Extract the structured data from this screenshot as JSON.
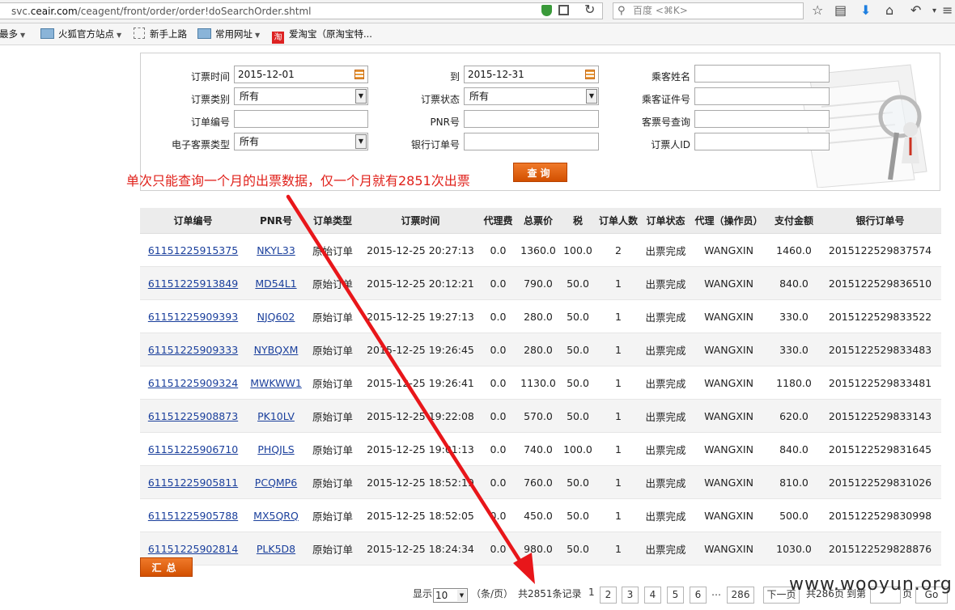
{
  "browser": {
    "url_prefix": "svc.",
    "url_domain": "ceair.com",
    "url_path": "/ceagent/front/order/order!doSearchOrder.shtml",
    "search_placeholder": "百度 <⌘K>",
    "bookmarks": [
      {
        "label": "访问最多"
      },
      {
        "label": "火狐官方站点"
      },
      {
        "label": "新手上路"
      },
      {
        "label": "常用网址"
      },
      {
        "label": "爱淘宝（原淘宝特..."
      }
    ]
  },
  "form": {
    "order_time_label": "订票时间",
    "order_time_from": "2015-12-01",
    "to_label": "到",
    "order_time_to": "2015-12-31",
    "passenger_name_label": "乘客姓名",
    "order_type_label": "订票类别",
    "order_type_value": "所有",
    "order_status_label": "订票状态",
    "order_status_value": "所有",
    "passenger_id_label": "乘客证件号",
    "order_no_label": "订单编号",
    "pnr_label": "PNR号",
    "ticket_query_label": "客票号查询",
    "eticket_type_label": "电子客票类型",
    "eticket_type_value": "所有",
    "bank_order_label": "银行订单号",
    "booker_id_label": "订票人ID",
    "query_button": "查询"
  },
  "annotation": "单次只能查询一个月的出票数据，仅一个月就有2851次出票",
  "table": {
    "headers": [
      "订单编号",
      "PNR号",
      "订单类型",
      "订票时间",
      "代理费",
      "总票价",
      "税",
      "订单人数",
      "订单状态",
      "代理（操作员）",
      "支付金额",
      "银行订单号"
    ],
    "rows": [
      [
        "61151225915375",
        "NKYL33",
        "原始订单",
        "2015-12-25 20:27:13",
        "0.0",
        "1360.0",
        "100.0",
        "2",
        "出票完成",
        "WANGXIN",
        "1460.0",
        "2015122529837574"
      ],
      [
        "61151225913849",
        "MD54L1",
        "原始订单",
        "2015-12-25 20:12:21",
        "0.0",
        "790.0",
        "50.0",
        "1",
        "出票完成",
        "WANGXIN",
        "840.0",
        "2015122529836510"
      ],
      [
        "61151225909393",
        "NJQ602",
        "原始订单",
        "2015-12-25 19:27:13",
        "0.0",
        "280.0",
        "50.0",
        "1",
        "出票完成",
        "WANGXIN",
        "330.0",
        "2015122529833522"
      ],
      [
        "61151225909333",
        "NYBQXM",
        "原始订单",
        "2015-12-25 19:26:45",
        "0.0",
        "280.0",
        "50.0",
        "1",
        "出票完成",
        "WANGXIN",
        "330.0",
        "2015122529833483"
      ],
      [
        "61151225909324",
        "MWKWW1",
        "原始订单",
        "2015-12-25 19:26:41",
        "0.0",
        "1130.0",
        "50.0",
        "1",
        "出票完成",
        "WANGXIN",
        "1180.0",
        "2015122529833481"
      ],
      [
        "61151225908873",
        "PK10LV",
        "原始订单",
        "2015-12-25 19:22:08",
        "0.0",
        "570.0",
        "50.0",
        "1",
        "出票完成",
        "WANGXIN",
        "620.0",
        "2015122529833143"
      ],
      [
        "61151225906710",
        "PHQJLS",
        "原始订单",
        "2015-12-25 19:01:13",
        "0.0",
        "740.0",
        "100.0",
        "1",
        "出票完成",
        "WANGXIN",
        "840.0",
        "2015122529831645"
      ],
      [
        "61151225905811",
        "PCQMP6",
        "原始订单",
        "2015-12-25 18:52:19",
        "0.0",
        "760.0",
        "50.0",
        "1",
        "出票完成",
        "WANGXIN",
        "810.0",
        "2015122529831026"
      ],
      [
        "61151225905788",
        "MX5QRQ",
        "原始订单",
        "2015-12-25 18:52:05",
        "0.0",
        "450.0",
        "50.0",
        "1",
        "出票完成",
        "WANGXIN",
        "500.0",
        "2015122529830998"
      ],
      [
        "61151225902814",
        "PLK5D8",
        "原始订单",
        "2015-12-25 18:24:34",
        "0.0",
        "980.0",
        "50.0",
        "1",
        "出票完成",
        "WANGXIN",
        "1030.0",
        "2015122529828876"
      ]
    ]
  },
  "summary_button": "汇总",
  "pager": {
    "show_label": "显示",
    "page_size": "10",
    "per_page_label": "（条/页）",
    "total_label": "共2851条记录",
    "current_page": "1",
    "pages": [
      "2",
      "3",
      "4",
      "5",
      "6"
    ],
    "ellipsis": "…",
    "last_page": "286",
    "next_label": "下一页",
    "total_pages_label": "共286页",
    "goto_label": "到第",
    "goto_suffix": "页",
    "go_label": "Go"
  },
  "watermark": "www.wooyun.org",
  "colors": {
    "accent": "#e0201a",
    "button": "#e06010",
    "link": "#1a3f9c"
  }
}
